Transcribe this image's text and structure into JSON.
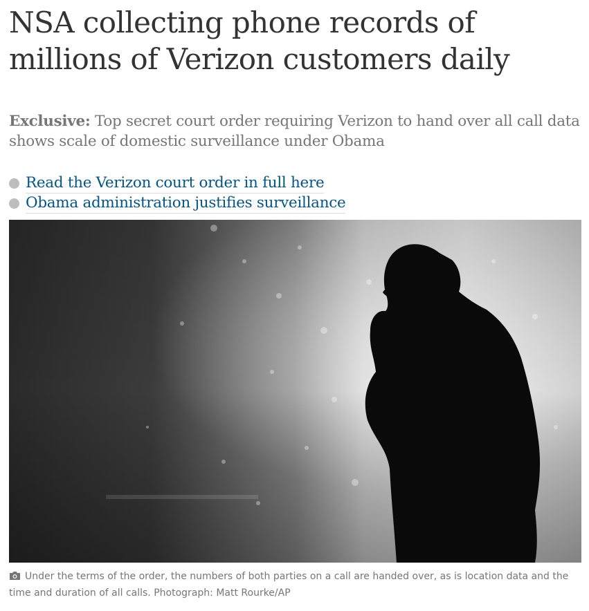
{
  "article": {
    "headline": "NSA collecting phone records of millions of Verizon customers daily",
    "standfirst": {
      "kicker": "Exclusive:",
      "text": " Top secret court order requiring Verizon to hand over all call data shows scale of domestic surveillance under Obama"
    },
    "related_links": [
      {
        "label": "Read the Verizon court order in full here"
      },
      {
        "label": "Obama administration justifies surveillance"
      }
    ],
    "image": {
      "icon": "camera-icon",
      "caption": "Under the terms of the order, the numbers of both parties on a call are handed over, as is location data and the time and duration of all calls. Photograph: Matt Rourke/AP"
    },
    "colors": {
      "headline": "#333333",
      "standfirst": "#767676",
      "link": "#005689",
      "bullet": "#bdbdbd"
    }
  }
}
